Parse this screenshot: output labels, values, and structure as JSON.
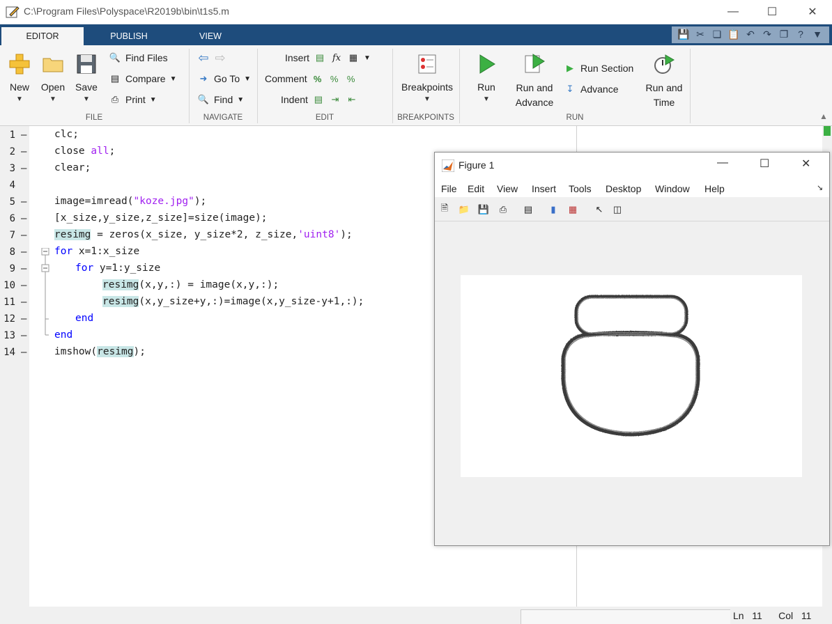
{
  "window": {
    "title": "C:\\Program Files\\Polyspace\\R2019b\\bin\\t1s5.m"
  },
  "tabs": [
    {
      "label": "EDITOR"
    },
    {
      "label": "PUBLISH"
    },
    {
      "label": "VIEW"
    }
  ],
  "toolstrip": {
    "file": {
      "label": "FILE",
      "new": "New",
      "open": "Open",
      "save": "Save",
      "find_files": "Find Files",
      "compare": "Compare",
      "print": "Print"
    },
    "navigate": {
      "label": "NAVIGATE",
      "go_to": "Go To",
      "find": "Find"
    },
    "edit": {
      "label": "EDIT",
      "insert": "Insert",
      "comment": "Comment",
      "indent": "Indent"
    },
    "breakpoints": {
      "label": "BREAKPOINTS",
      "button": "Breakpoints"
    },
    "run": {
      "label": "RUN",
      "run": "Run",
      "run_and_advance_1": "Run and",
      "run_and_advance_2": "Advance",
      "run_section": "Run Section",
      "advance": "Advance",
      "run_and_time_1": "Run and",
      "run_and_time_2": "Time"
    }
  },
  "editor": {
    "lines": [
      {
        "n": "1",
        "dash": "–"
      },
      {
        "n": "2",
        "dash": "–"
      },
      {
        "n": "3",
        "dash": "–"
      },
      {
        "n": "4",
        "dash": ""
      },
      {
        "n": "5",
        "dash": "–"
      },
      {
        "n": "6",
        "dash": "–"
      },
      {
        "n": "7",
        "dash": "–"
      },
      {
        "n": "8",
        "dash": "–"
      },
      {
        "n": "9",
        "dash": "–"
      },
      {
        "n": "10",
        "dash": "–"
      },
      {
        "n": "11",
        "dash": "–"
      },
      {
        "n": "12",
        "dash": "–"
      },
      {
        "n": "13",
        "dash": "–"
      },
      {
        "n": "14",
        "dash": "–"
      }
    ],
    "code": {
      "l1": "clc;",
      "l2a": "close ",
      "l2b": "all",
      "l2c": ";",
      "l3": "clear;",
      "l5a": "image=imread(",
      "l5b": "\"koze.jpg\"",
      "l5c": ");",
      "l6": "[x_size,y_size,z_size]=size(image);",
      "l7a": "resimg",
      "l7b": " = zeros(x_size, y_size*2, z_size,",
      "l7c": "'uint8'",
      "l7d": ");",
      "l8a": "for",
      "l8b": " x=1:x_size",
      "l9a": "for",
      "l9b": " y=1:y_size",
      "l10a": "resimg",
      "l10b": "(x,y,:) = image(x,y,:);",
      "l11a": "resimg",
      "l11b": "(x,y_size+y,:)=image(x,y_size-y+1,:);",
      "l12": "end",
      "l13": "end",
      "l14a": "imshow(",
      "l14b": "resimg",
      "l14c": ");"
    }
  },
  "status": {
    "ln_label": "Ln",
    "ln": "11",
    "col_label": "Col",
    "col": "11"
  },
  "figure": {
    "title": "Figure 1",
    "menu": [
      "File",
      "Edit",
      "View",
      "Insert",
      "Tools",
      "Desktop",
      "Window",
      "Help"
    ]
  }
}
